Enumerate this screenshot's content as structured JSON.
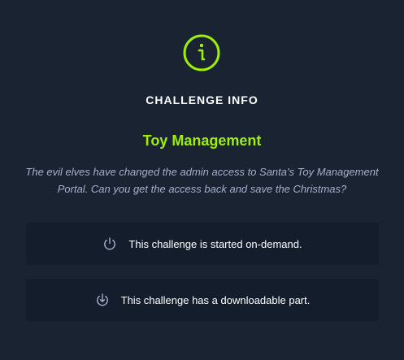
{
  "colors": {
    "background": "#1a2332",
    "card_background": "#141d2b",
    "accent": "#9fef00",
    "muted_text": "#a4b1cd"
  },
  "header": {
    "icon": "info-circle-icon",
    "title": "CHALLENGE INFO"
  },
  "challenge": {
    "name": "Toy Management",
    "description": "The evil elves have changed the admin access to Santa's Toy Management Portal. Can you get the access back and save the Christmas?"
  },
  "features": [
    {
      "icon": "power-icon",
      "text": "This challenge is started on-demand."
    },
    {
      "icon": "download-icon",
      "text": "This challenge has a downloadable part."
    }
  ]
}
